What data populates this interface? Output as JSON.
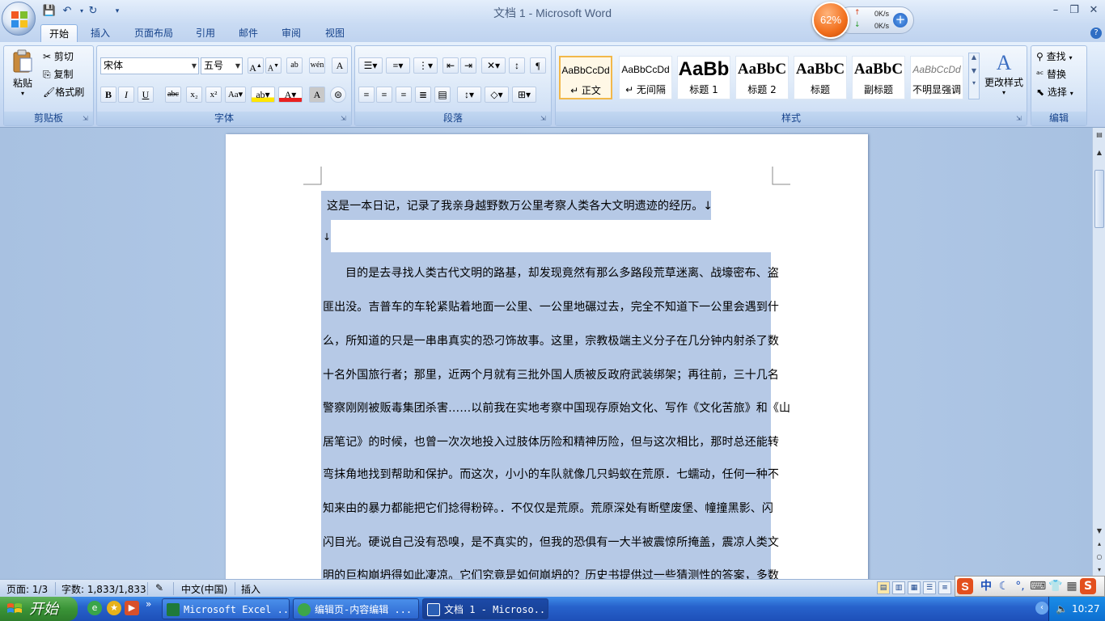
{
  "window": {
    "title": "文档 1 - Microsoft Word",
    "minimize": "–",
    "restore": "❐",
    "close": "✕"
  },
  "netmon": {
    "percent": "62%",
    "up": "0K/s",
    "down": "0K/s"
  },
  "tabs": [
    "开始",
    "插入",
    "页面布局",
    "引用",
    "邮件",
    "审阅",
    "视图"
  ],
  "clipboard": {
    "paste": "粘贴",
    "cut": "剪切",
    "copy": "复制",
    "format_painter": "格式刷",
    "group": "剪贴板"
  },
  "font": {
    "name": "宋体",
    "size": "五号",
    "group": "字体"
  },
  "paragraph": {
    "group": "段落"
  },
  "styles": {
    "group": "样式",
    "change": "更改样式",
    "items": [
      {
        "sample": "AaBbCcDd",
        "name": "↵ 正文"
      },
      {
        "sample": "AaBbCcDd",
        "name": "↵ 无间隔"
      },
      {
        "sample": "AaBb",
        "name": "标题 1"
      },
      {
        "sample": "AaBbC",
        "name": "标题 2"
      },
      {
        "sample": "AaBbC",
        "name": "标题"
      },
      {
        "sample": "AaBbC",
        "name": "副标题"
      },
      {
        "sample": "AaBbCcDd",
        "name": "不明显强调"
      }
    ]
  },
  "editing": {
    "find": "查找",
    "replace": "替换",
    "select": "选择",
    "group": "编辑"
  },
  "document": {
    "lines": [
      "这是一本日记，记录了我亲身越野数万公里考察人类各大文明遗迹的经历。↓",
      "↓",
      "目的是去寻找人类古代文明的路基，却发现竟然有那么多路段荒草迷离、战壕密布、盗",
      "匪出没。吉普车的车轮紧贴着地面一公里、一公里地碾过去，完全不知道下一公里会遇到什",
      "么，所知道的只是一串串真实的恐刁饰故事。这里，宗教极端主义分子在几分钟内射杀了数",
      "十名外国旅行者；那里，近两个月就有三批外国人质被反政府武装绑架；再往前，三十几名",
      "警察刚刚被贩毒集团杀害……以前我在实地考察中国现存原始文化、写作《文化苦旅》和《山",
      "居笔记》的时候，也曾一次次地投入过肢体历险和精神历险，但与这次相比，那时总还能转",
      "弯抹角地找到帮助和保护。而这次，小小的车队就像几只蚂蚁在荒原．七蠕动，任何一种不",
      "知来由的暴力都能把它们捻得粉碎。．不仅仅是荒原。荒原深处有断壁废堡、幢撞黑影、闪",
      "闪目光。硬说自己没有恐嗅，是不真实的，但我的恐俱有一大半被震惊所掩盖，震凉人类文",
      "明的巨构崩坍得如此凄凉。它们究竟是如何崩坍的？历史书提供过一些猜测性的答案，多数"
    ]
  },
  "status": {
    "page": "页面: 1/3",
    "words": "字数: 1,833/1,833",
    "language": "中文(中国)",
    "mode": "插入"
  },
  "ime": {
    "label": "中"
  },
  "taskbar": {
    "start": "开始",
    "more": "»",
    "tasks": [
      {
        "label": "Microsoft Excel ...",
        "color": "#1f7a3a"
      },
      {
        "label": "编辑页-内容编辑 ...",
        "color": "#3da64a"
      },
      {
        "label": "文档 1 - Microso...",
        "color": "#2b5fb5"
      }
    ],
    "clock": "10:27"
  }
}
